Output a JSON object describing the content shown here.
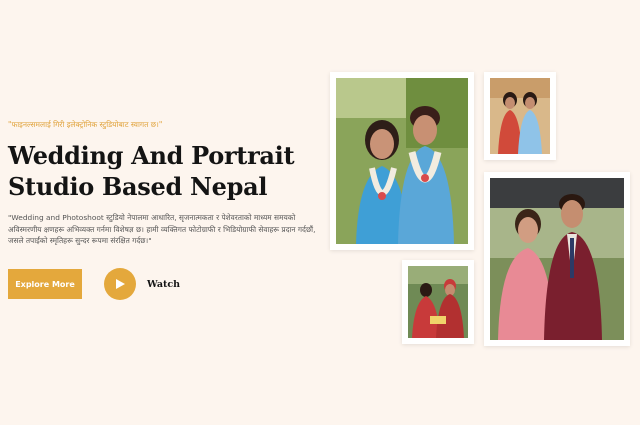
{
  "hero": {
    "tagline": "\"फाइनल्समलाई गिरी इलेक्ट्रोनिक स्टुडियोबाट स्वागत छ।\"",
    "title_line1": "Wedding And Portrait",
    "title_line2": "Studio Based Nepal",
    "description": "\"Wedding and Photoshoot स्टुडियो नेपालमा आधारित, सृजनात्मकता र पेशेवरताको माध्यम समयको अविस्मरणीय क्षणहरू अभिव्यक्त गर्नमा विशेषज्ञ छ। हामी व्यक्तिगत फोटोग्राफी र भिडियोग्राफी सेवाहरू प्रदान गर्दछौं, जसले तपाईंको स्मृतिहरू सुन्दर रूपमा संरक्षित गर्दछ।\""
  },
  "actions": {
    "explore_label": "Explore More",
    "watch_label": "Watch"
  },
  "gallery": {
    "photos": [
      {
        "name": "couple-portrait-photo",
        "colors": {
          "bg": "#8aa45a",
          "bride": "#3f9fd6",
          "groom": "#5aa7d8",
          "garland": "#f2ece0"
        }
      },
      {
        "name": "couple-small-photo",
        "colors": {
          "bg": "#d9b88a",
          "left": "#d14a3a",
          "right": "#8fc3e8"
        }
      },
      {
        "name": "couple-suit-photo",
        "colors": {
          "bg": "#7c8f5a",
          "bride": "#e88a95",
          "groom": "#7a1f2e"
        }
      },
      {
        "name": "ceremony-photo",
        "colors": {
          "bg": "#6f8a55",
          "people": "#c83a3a"
        }
      }
    ]
  },
  "colors": {
    "accent": "#e4a83c",
    "background": "#fdf5ee",
    "title": "#141414"
  }
}
